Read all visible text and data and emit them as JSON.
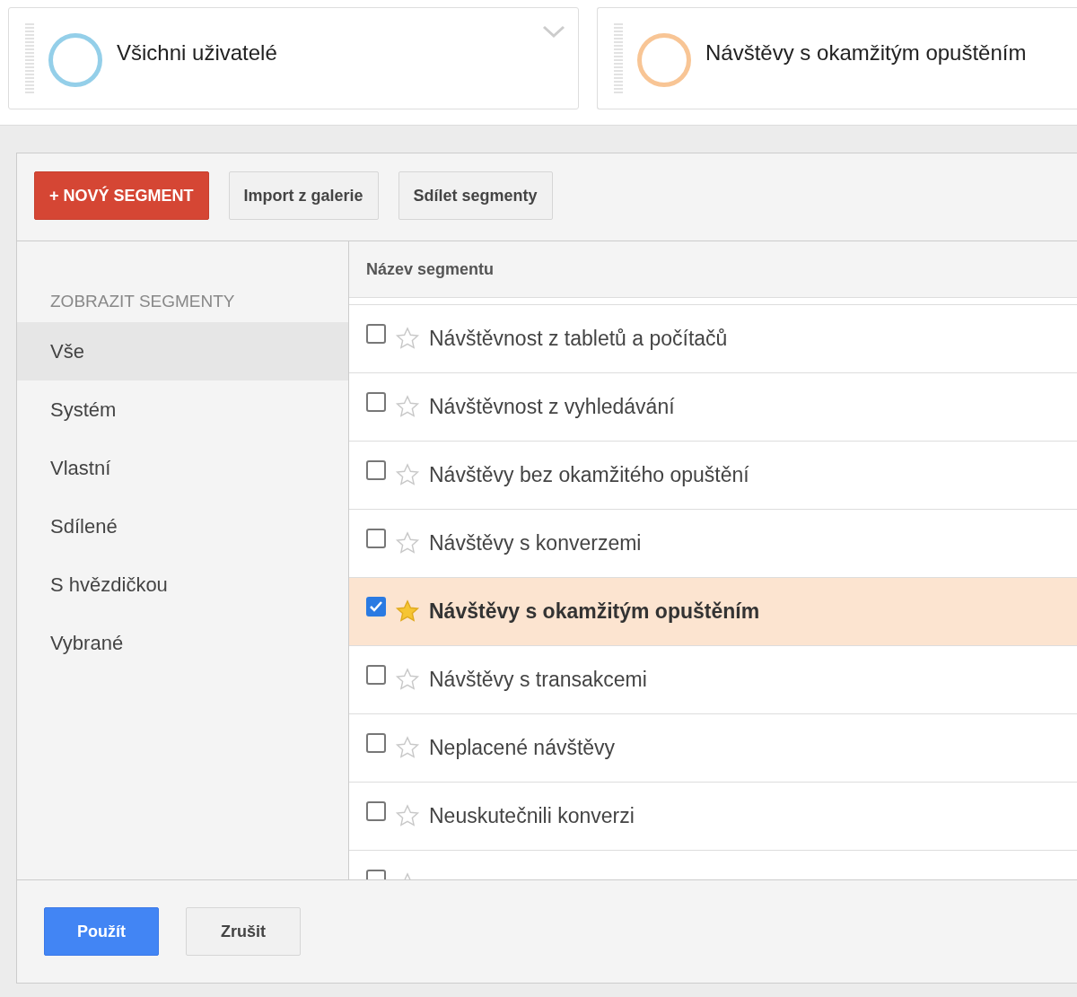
{
  "segment_cards": [
    {
      "label": "Všichni uživatelé",
      "color": "#94cfe9",
      "has_menu": true
    },
    {
      "label": "Návštěvy s okamžitým opuštěním",
      "color": "#f8c595",
      "has_menu": false
    }
  ],
  "toolbar": {
    "new_button": "+ NOVÝ SEGMENT",
    "import_button": "Import z galerie",
    "share_button": "Sdílet segmenty"
  },
  "sidebar": {
    "heading": "ZOBRAZIT SEGMENTY",
    "items": [
      {
        "label": "Vše",
        "selected": true
      },
      {
        "label": "Systém",
        "selected": false
      },
      {
        "label": "Vlastní",
        "selected": false
      },
      {
        "label": "Sdílené",
        "selected": false
      },
      {
        "label": "S hvězdičkou",
        "selected": false
      },
      {
        "label": "Vybrané",
        "selected": false
      }
    ]
  },
  "table": {
    "column": "Název segmentu",
    "rows": [
      {
        "label": "Návštěvnost z tabletů a počítačů",
        "checked": false,
        "starred": false
      },
      {
        "label": "Návštěvnost z vyhledávání",
        "checked": false,
        "starred": false
      },
      {
        "label": "Návštěvy bez okamžitého opuštění",
        "checked": false,
        "starred": false
      },
      {
        "label": "Návštěvy s konverzemi",
        "checked": false,
        "starred": false
      },
      {
        "label": "Návštěvy s okamžitým opuštěním",
        "checked": true,
        "starred": true
      },
      {
        "label": "Návštěvy s transakcemi",
        "checked": false,
        "starred": false
      },
      {
        "label": "Neplacené návštěvy",
        "checked": false,
        "starred": false
      },
      {
        "label": "Neuskutečnili konverzi",
        "checked": false,
        "starred": false
      },
      {
        "checked": false,
        "starred": false
      }
    ]
  },
  "footer": {
    "apply_button": "Použít",
    "cancel_button": "Zrušit"
  }
}
